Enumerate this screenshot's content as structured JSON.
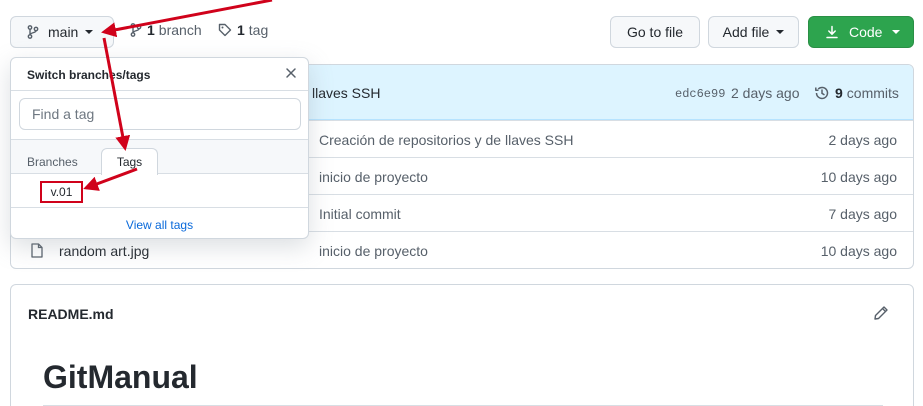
{
  "branch_button": {
    "label": "main"
  },
  "counts": {
    "branches_count": "1",
    "branches_label": "branch",
    "tags_count": "1",
    "tags_label": "tag"
  },
  "toolbar": {
    "goto_label": "Go to file",
    "addfile_label": "Add file",
    "code_label": "Code"
  },
  "commit": {
    "message": "llaves SSH",
    "sha": "edc6e99",
    "age": "2 days ago",
    "count": "9",
    "count_label": "commits"
  },
  "files": [
    {
      "name": "",
      "message": "Creación de repositorios y de llaves SSH",
      "age": "2 days ago"
    },
    {
      "name": "",
      "message": "inicio de proyecto",
      "age": "10 days ago"
    },
    {
      "name": "",
      "message": "Initial commit",
      "age": "7 days ago"
    },
    {
      "name": "random art.jpg",
      "message": "inicio de proyecto",
      "age": "10 days ago"
    }
  ],
  "dropdown": {
    "title": "Switch branches/tags",
    "search_placeholder": "Find a tag",
    "tab_branches": "Branches",
    "tab_tags": "Tags",
    "tag_item": "v.01",
    "view_all": "View all tags"
  },
  "readme": {
    "filename": "README.md",
    "heading": "GitManual"
  },
  "icons": {
    "branch": "git-branch-icon",
    "tag": "tag-icon",
    "download": "download-icon",
    "history": "history-icon",
    "file": "file-icon",
    "close": "close-icon",
    "edit": "pencil-icon"
  },
  "colors": {
    "code_button": "#2da44e",
    "commit_bar": "#ddf4ff",
    "annotation": "#d0021b",
    "link": "#0969da"
  }
}
